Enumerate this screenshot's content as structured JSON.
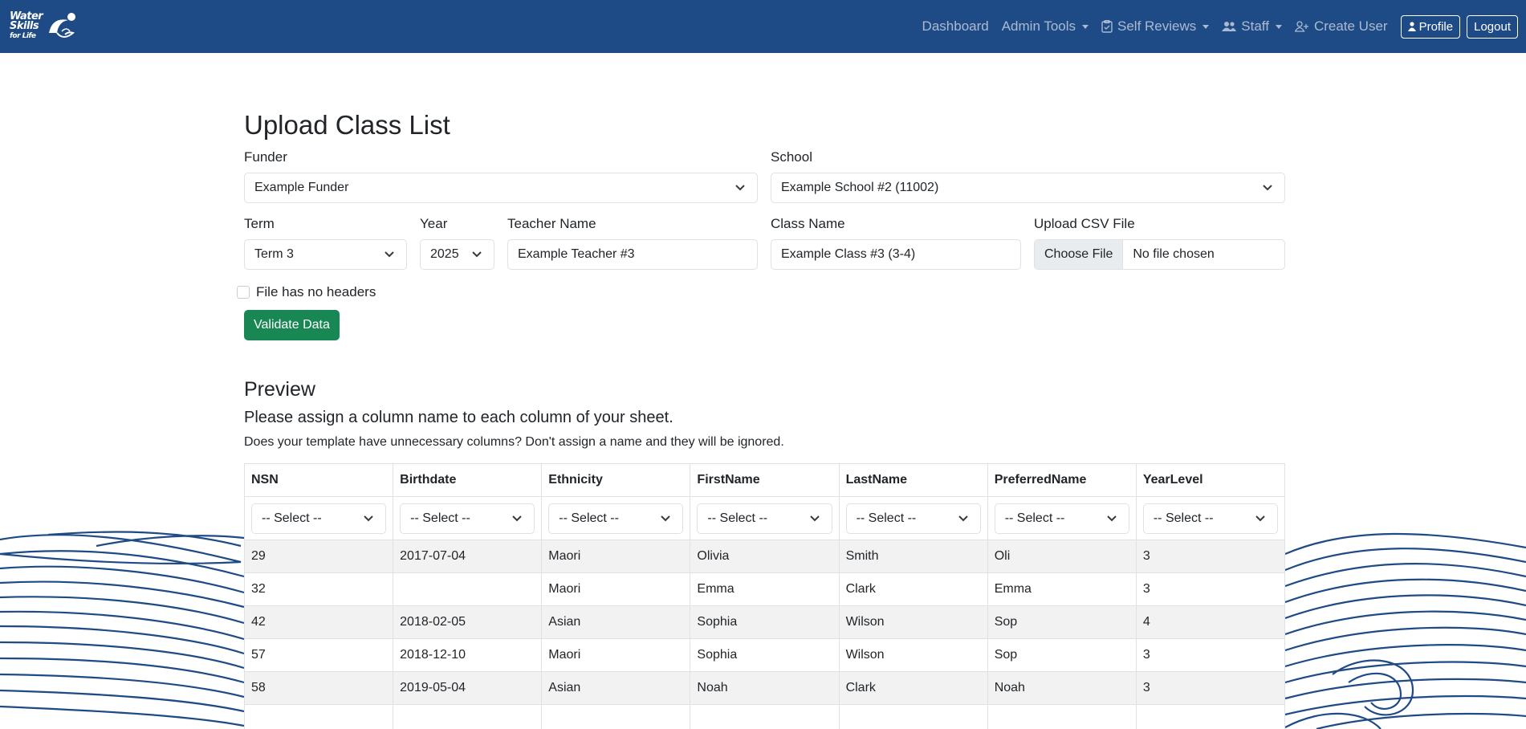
{
  "brand": {
    "line1": "Water",
    "line2": "Skills",
    "line3": "for Life"
  },
  "nav": {
    "dashboard": "Dashboard",
    "admin_tools": "Admin Tools",
    "self_reviews": "Self Reviews",
    "staff": "Staff",
    "create_user": "Create User",
    "profile": "Profile",
    "logout": "Logout"
  },
  "page": {
    "title": "Upload Class List",
    "funder": {
      "label": "Funder",
      "value": "Example Funder"
    },
    "school": {
      "label": "School",
      "value": "Example School #2 (11002)"
    },
    "term": {
      "label": "Term",
      "value": "Term 3"
    },
    "year": {
      "label": "Year",
      "value": "2025"
    },
    "teacher": {
      "label": "Teacher Name",
      "value": "Example Teacher #3"
    },
    "class_name": {
      "label": "Class Name",
      "value": "Example Class #3 (3-4)"
    },
    "upload": {
      "label": "Upload CSV File",
      "button": "Choose File",
      "status": "No file chosen"
    },
    "no_headers_label": "File has no headers",
    "validate_label": "Validate Data"
  },
  "preview": {
    "title": "Preview",
    "subtitle": "Please assign a column name to each column of your sheet.",
    "note": "Does your template have unnecessary columns? Don't assign a name and they will be ignored.",
    "select_placeholder": "-- Select --",
    "columns": [
      "NSN",
      "Birthdate",
      "Ethnicity",
      "FirstName",
      "LastName",
      "PreferredName",
      "YearLevel"
    ],
    "rows": [
      [
        "29",
        "2017-07-04",
        "Maori",
        "Olivia",
        "Smith",
        "Oli",
        "3"
      ],
      [
        "32",
        "",
        "Maori",
        "Emma",
        "Clark",
        "Emma",
        "3"
      ],
      [
        "42",
        "2018-02-05",
        "Asian",
        "Sophia",
        "Wilson",
        "Sop",
        "4"
      ],
      [
        "57",
        "2018-12-10",
        "Maori",
        "Sophia",
        "Wilson",
        "Sop",
        "3"
      ],
      [
        "58",
        "2019-05-04",
        "Asian",
        "Noah",
        "Clark",
        "Noah",
        "3"
      ]
    ]
  },
  "colors": {
    "navbar": "#1e4a85",
    "success": "#198754",
    "wave": "#1e4a85"
  }
}
